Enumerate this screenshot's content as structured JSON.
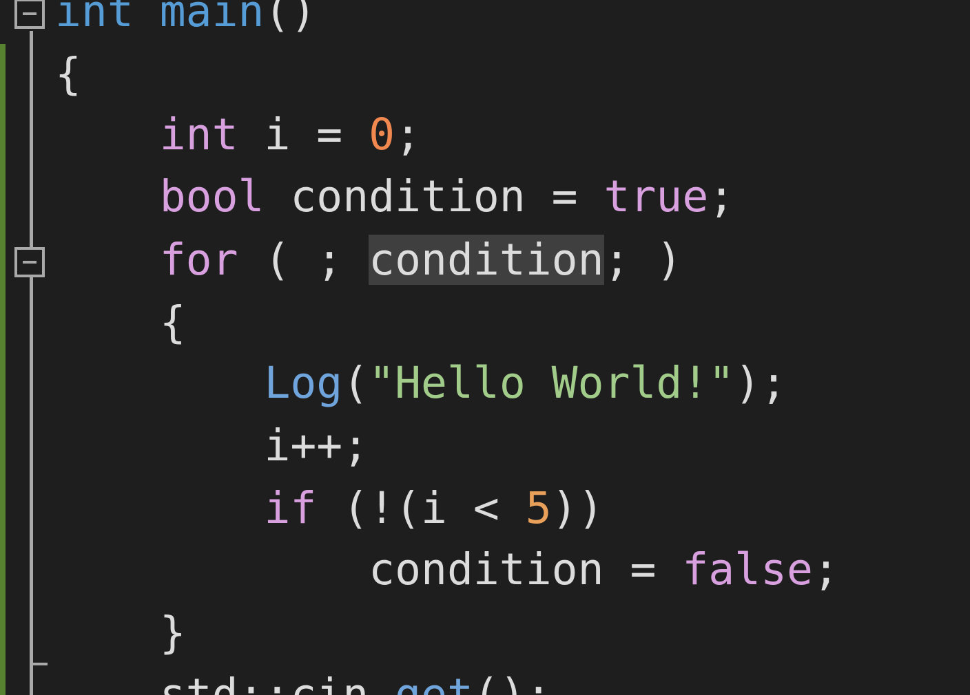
{
  "code": {
    "line1": {
      "type": "int",
      "space": " ",
      "name": "main",
      "parens": "()"
    },
    "line2": {
      "text": "{"
    },
    "line3": {
      "indent": "    ",
      "type": "int",
      "rest": " i = ",
      "value": "0",
      "end": ";"
    },
    "line4": {
      "indent": "    ",
      "type": "bool",
      "rest": " condition = ",
      "value": "true",
      "end": ";"
    },
    "line5": {
      "indent": "    ",
      "keyword": "for",
      "rest": " ( ; ",
      "highlight": "condition",
      "end": "; )"
    },
    "line6": {
      "indent": "    ",
      "text": "{"
    },
    "line7": {
      "indent": "        ",
      "func": "Log",
      "open": "(",
      "string": "\"Hello World!\"",
      "end": ");"
    },
    "line8": {
      "indent": "        ",
      "text": "i++;"
    },
    "line9": {
      "indent": "        ",
      "keyword": "if",
      "rest": " (!(i < ",
      "value": "5",
      "end": "))"
    },
    "line10": {
      "indent": "            ",
      "text": "condition = ",
      "value": "false",
      "end": ";"
    },
    "line11": {
      "indent": "    ",
      "text": "}"
    },
    "line12": {
      "indent": "    ",
      "ns": "std::cin.",
      "func": "get",
      "end": "();"
    }
  },
  "colors": {
    "background": "#1e1e1e",
    "keyword": "#d8a0df",
    "type_keyword": "#569cd6",
    "function": "#6fa5dc",
    "number": "#f08850",
    "string": "#a2cc8a",
    "text": "#dcdcdc",
    "change_bar": "#57822f",
    "guide": "#a9a9a9"
  },
  "icons": {
    "fold_main": "collapse-minus-icon",
    "fold_for": "collapse-minus-icon"
  }
}
